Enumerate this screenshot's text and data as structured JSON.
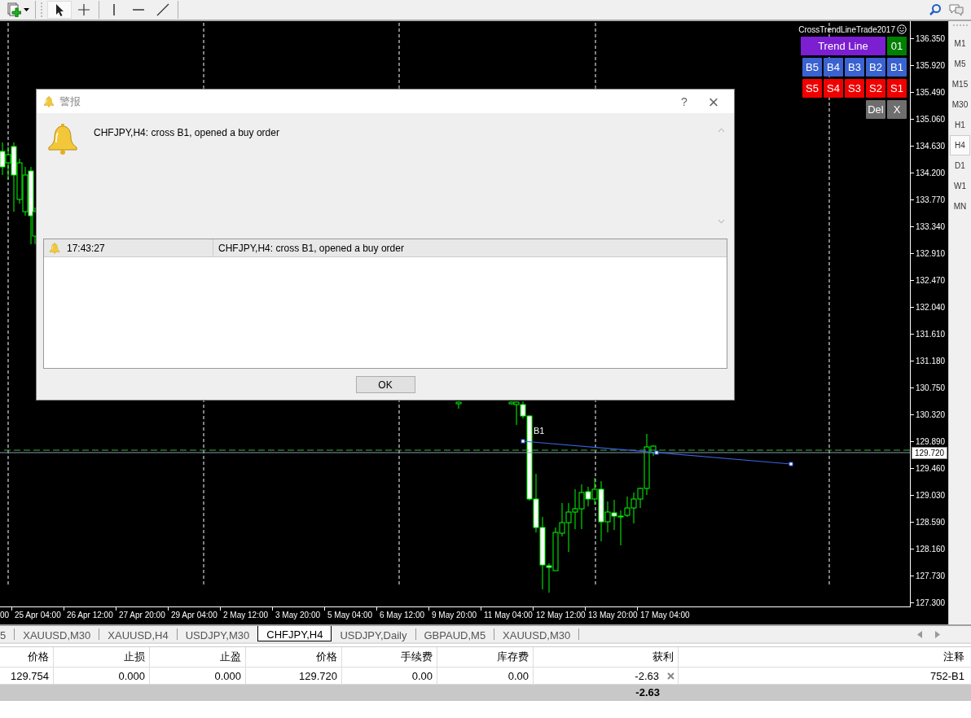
{
  "toolbar": {
    "tools": [
      {
        "kind": "cursor",
        "selected": true
      },
      {
        "kind": "crosshair",
        "selected": false
      },
      {
        "kind": "vline",
        "selected": false
      },
      {
        "kind": "hline",
        "selected": false
      },
      {
        "kind": "trendline",
        "selected": false
      }
    ]
  },
  "chart": {
    "indicator": {
      "title": "CrossTrendLineTrade2017",
      "mode_buttons": [
        {
          "label": "Trend Line",
          "color": "#7b1fd1",
          "wide": true
        },
        {
          "label": "01",
          "color": "#008000",
          "wide": false
        }
      ],
      "buy_buttons": [
        {
          "label": "B5",
          "color": "#3a62d0",
          "wide": false
        },
        {
          "label": "B4",
          "color": "#3a62d0",
          "wide": false
        },
        {
          "label": "B3",
          "color": "#3a62d0",
          "wide": false
        },
        {
          "label": "B2",
          "color": "#3a62d0",
          "wide": false
        },
        {
          "label": "B1",
          "color": "#3a62d0",
          "wide": false
        }
      ],
      "sell_buttons": [
        {
          "label": "S5",
          "color": "#f00000",
          "wide": false
        },
        {
          "label": "S4",
          "color": "#f00000",
          "wide": false
        },
        {
          "label": "S3",
          "color": "#f00000",
          "wide": false
        },
        {
          "label": "S2",
          "color": "#f00000",
          "wide": false
        },
        {
          "label": "S1",
          "color": "#f00000",
          "wide": false
        }
      ],
      "control_buttons": [
        {
          "label": "Del",
          "color": "#6e6e6e",
          "wide": false
        },
        {
          "label": "X",
          "color": "#6e6e6e",
          "wide": false
        }
      ]
    },
    "object_label": "B1",
    "price_axis": [
      "136.350",
      "135.920",
      "135.490",
      "135.060",
      "134.630",
      "134.200",
      "133.770",
      "133.340",
      "132.910",
      "132.470",
      "132.040",
      "131.610",
      "131.180",
      "130.750",
      "130.320",
      "129.890",
      "129.460",
      "129.030",
      "128.590",
      "128.160",
      "127.730",
      "127.300"
    ],
    "current_price": "129.720",
    "time_axis": [
      "00",
      "25 Apr 04:00",
      "26 Apr 12:00",
      "27 Apr 20:00",
      "29 Apr 04:00",
      "2 May 12:00",
      "3 May 20:00",
      "5 May 04:00",
      "6 May 12:00",
      "9 May 20:00",
      "11 May 04:00",
      "12 May 12:00",
      "13 May 20:00",
      "17 May 04:00"
    ]
  },
  "timeframes": [
    {
      "label": "M1",
      "selected": false
    },
    {
      "label": "M5",
      "selected": false
    },
    {
      "label": "M15",
      "selected": false
    },
    {
      "label": "M30",
      "selected": false
    },
    {
      "label": "H1",
      "selected": false
    },
    {
      "label": "H4",
      "selected": true
    },
    {
      "label": "D1",
      "selected": false
    },
    {
      "label": "W1",
      "selected": false
    },
    {
      "label": "MN",
      "selected": false
    }
  ],
  "chart_tabs": [
    {
      "label": "5",
      "selected": false
    },
    {
      "label": "XAUUSD,M30",
      "selected": false
    },
    {
      "label": "XAUUSD,H4",
      "selected": false
    },
    {
      "label": "USDJPY,M30",
      "selected": false
    },
    {
      "label": "CHFJPY,H4",
      "selected": true
    },
    {
      "label": "USDJPY,Daily",
      "selected": false
    },
    {
      "label": "GBPAUD,M5",
      "selected": false
    },
    {
      "label": "XAUUSD,M30",
      "selected": false
    }
  ],
  "alert_dialog": {
    "title": "警报",
    "help": "?",
    "close": "×",
    "message": "CHFJPY,H4: cross B1, opened a buy order",
    "log": [
      {
        "time": "17:43:27",
        "message": "CHFJPY,H4: cross B1, opened a buy order"
      }
    ],
    "ok": "OK"
  },
  "trades_table": {
    "columns": [
      "价格",
      "止损",
      "止盈",
      "价格",
      "手续费",
      "库存费",
      "获利",
      "注释"
    ],
    "rows": [
      {
        "cells": [
          "129.754",
          "0.000",
          "0.000",
          "129.720",
          "0.00",
          "0.00",
          "-2.63",
          "752-B1"
        ]
      }
    ],
    "total": "-2.63"
  }
}
